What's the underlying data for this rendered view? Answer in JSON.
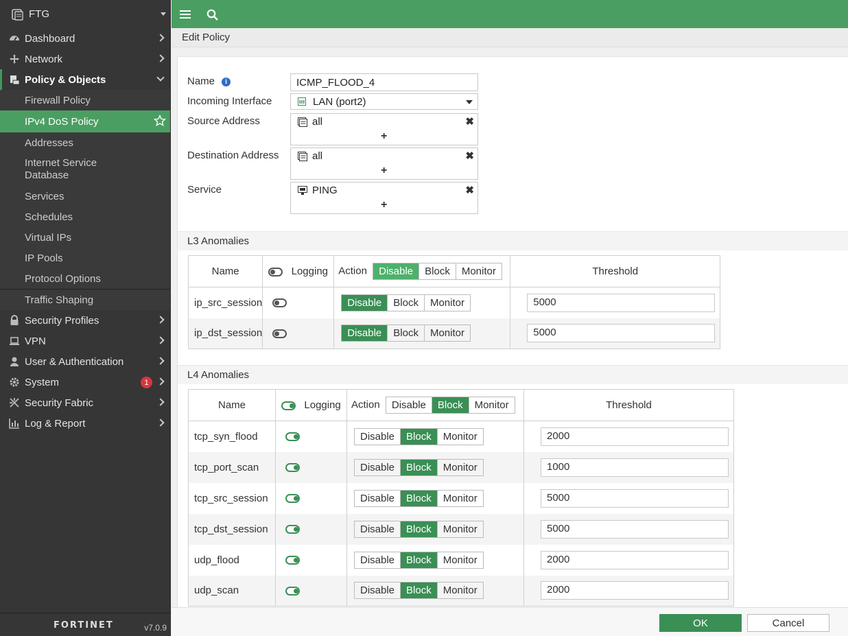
{
  "sidebar": {
    "device": "FTG",
    "nav": {
      "dashboard": "Dashboard",
      "network": "Network",
      "policy_objects": "Policy & Objects",
      "security_profiles": "Security Profiles",
      "vpn": "VPN",
      "user_auth": "User & Authentication",
      "system": "System",
      "security_fabric": "Security Fabric",
      "log_report": "Log & Report"
    },
    "system_badge": "1",
    "sub_items": {
      "firewall_policy": "Firewall Policy",
      "ipv4_dos_policy": "IPv4 DoS Policy",
      "addresses": "Addresses",
      "isdb_line1": "Internet Service",
      "isdb_line2": "Database",
      "services": "Services",
      "schedules": "Schedules",
      "virtual_ips": "Virtual IPs",
      "ip_pools": "IP Pools",
      "protocol_options": "Protocol Options",
      "traffic_shaping": "Traffic Shaping"
    },
    "logo": "FORTINET",
    "version": "v7.0.9"
  },
  "page_title": "Edit Policy",
  "form": {
    "name_label": "Name",
    "name_value": "ICMP_FLOOD_4",
    "incoming_label": "Incoming Interface",
    "incoming_value": "LAN (port2)",
    "source_label": "Source Address",
    "source_value": "all",
    "dest_label": "Destination Address",
    "dest_value": "all",
    "service_label": "Service",
    "service_value": "PING"
  },
  "l3": {
    "title": "L3 Anomalies",
    "headers": {
      "name": "Name",
      "logging": "Logging",
      "action": "Action",
      "threshold": "Threshold"
    },
    "header_action_options": [
      "Disable",
      "Block",
      "Monitor"
    ],
    "logging_on": false,
    "rows": [
      {
        "name": "ip_src_session",
        "logging": false,
        "action": "Disable",
        "threshold": "5000"
      },
      {
        "name": "ip_dst_session",
        "logging": false,
        "action": "Disable",
        "threshold": "5000"
      }
    ]
  },
  "l4": {
    "title": "L4 Anomalies",
    "headers": {
      "name": "Name",
      "logging": "Logging",
      "action": "Action",
      "threshold": "Threshold"
    },
    "header_action_options": [
      "Disable",
      "Block",
      "Monitor"
    ],
    "logging_on": true,
    "rows": [
      {
        "name": "tcp_syn_flood",
        "logging": true,
        "action": "Block",
        "threshold": "2000"
      },
      {
        "name": "tcp_port_scan",
        "logging": true,
        "action": "Block",
        "threshold": "1000"
      },
      {
        "name": "tcp_src_session",
        "logging": true,
        "action": "Block",
        "threshold": "5000"
      },
      {
        "name": "tcp_dst_session",
        "logging": true,
        "action": "Block",
        "threshold": "5000"
      },
      {
        "name": "udp_flood",
        "logging": true,
        "action": "Block",
        "threshold": "2000"
      },
      {
        "name": "udp_scan",
        "logging": true,
        "action": "Block",
        "threshold": "2000"
      }
    ]
  },
  "buttons": {
    "ok": "OK",
    "cancel": "Cancel"
  },
  "colors": {
    "accent": "#4a9e62",
    "selected": "#3a8f55",
    "sidebar_bg": "#363636"
  }
}
